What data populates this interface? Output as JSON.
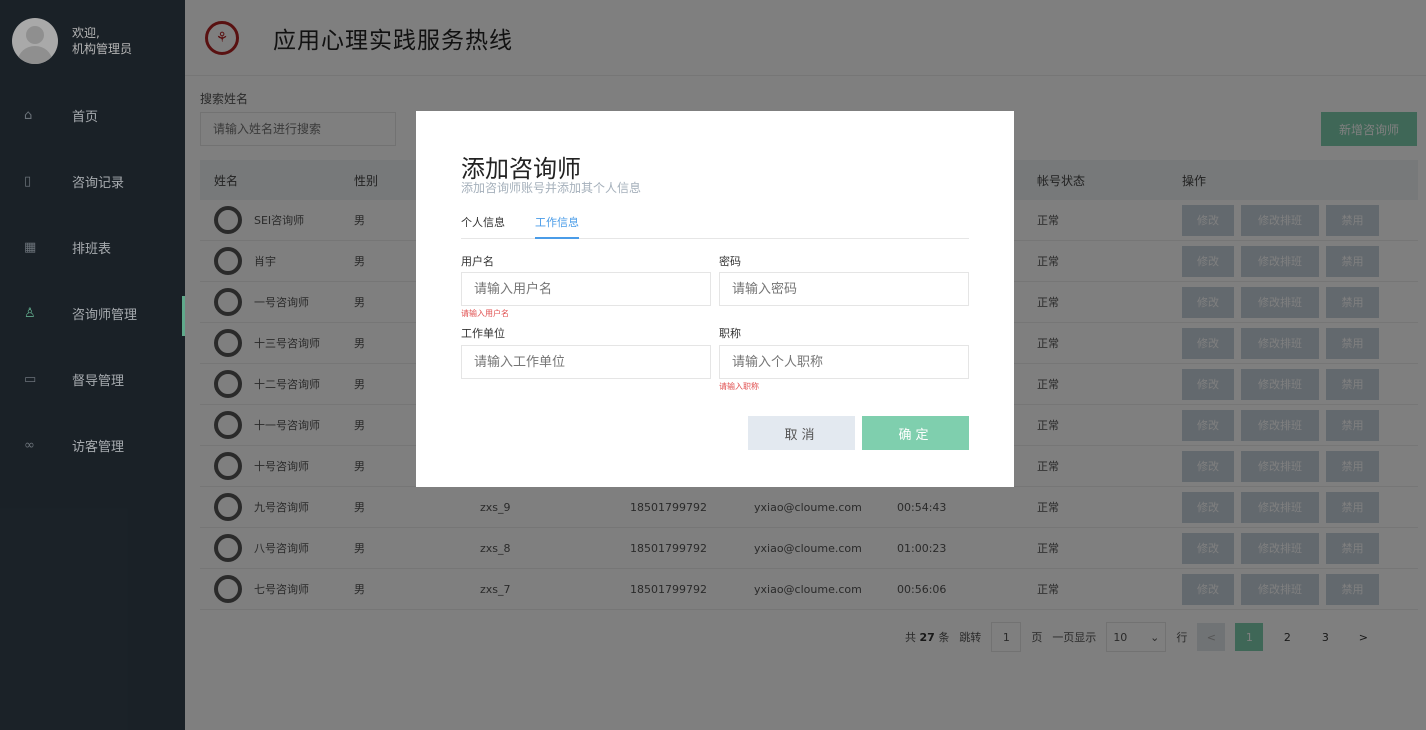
{
  "sidebar": {
    "welcome_line1": "欢迎,",
    "welcome_line2": "机构管理员",
    "items": [
      {
        "label": "首页",
        "icon": "home-icon",
        "glyph": "⌂"
      },
      {
        "label": "咨询记录",
        "icon": "record-icon",
        "glyph": "▯"
      },
      {
        "label": "排班表",
        "icon": "calendar-icon",
        "glyph": "▦"
      },
      {
        "label": "咨询师管理",
        "icon": "user-icon",
        "glyph": "♙"
      },
      {
        "label": "督导管理",
        "icon": "monitor-icon",
        "glyph": "▭"
      },
      {
        "label": "访客管理",
        "icon": "glasses-icon",
        "glyph": "∞"
      }
    ],
    "accent_color": "#7bd9b2"
  },
  "header": {
    "title": "应用心理实践服务热线",
    "logo_glyph": "⚘"
  },
  "search": {
    "label": "搜索姓名",
    "placeholder": "请输入姓名进行搜索"
  },
  "add_button": "新增咨询师",
  "table": {
    "headers": [
      "姓名",
      "性别",
      "",
      "",
      "",
      "",
      "帐号状态",
      "操作"
    ],
    "rows": [
      {
        "name": "SEI咨询师",
        "gender": "男",
        "username": "",
        "phone": "",
        "email": "",
        "time": "",
        "status": "正常"
      },
      {
        "name": "肖宇",
        "gender": "男",
        "username": "",
        "phone": "",
        "email": "",
        "time": "",
        "status": "正常"
      },
      {
        "name": "一号咨询师",
        "gender": "男",
        "username": "",
        "phone": "",
        "email": "",
        "time": "",
        "status": "正常"
      },
      {
        "name": "十三号咨询师",
        "gender": "男",
        "username": "",
        "phone": "",
        "email": "",
        "time": "",
        "status": "正常"
      },
      {
        "name": "十二号咨询师",
        "gender": "男",
        "username": "",
        "phone": "",
        "email": "",
        "time": "",
        "status": "正常"
      },
      {
        "name": "十一号咨询师",
        "gender": "男",
        "username": "",
        "phone": "",
        "email": "",
        "time": "",
        "status": "正常"
      },
      {
        "name": "十号咨询师",
        "gender": "男",
        "username": "",
        "phone": "",
        "email": "",
        "time": "",
        "status": "正常"
      },
      {
        "name": "九号咨询师",
        "gender": "男",
        "username": "zxs_9",
        "phone": "18501799792",
        "email": "yxiao@cloume.com",
        "time": "00:54:43",
        "status": "正常"
      },
      {
        "name": "八号咨询师",
        "gender": "男",
        "username": "zxs_8",
        "phone": "18501799792",
        "email": "yxiao@cloume.com",
        "time": "01:00:23",
        "status": "正常"
      },
      {
        "name": "七号咨询师",
        "gender": "男",
        "username": "zxs_7",
        "phone": "18501799792",
        "email": "yxiao@cloume.com",
        "time": "00:56:06",
        "status": "正常"
      }
    ],
    "ops": {
      "edit": "修改",
      "schedule": "修改排班",
      "ban": "禁用"
    }
  },
  "pager": {
    "total_prefix": "共",
    "total": "27",
    "total_suffix": "条",
    "jump_label": "跳转",
    "jump_value": "1",
    "page_unit": "页",
    "per_page_label": "一页显示",
    "per_page_value": "10",
    "row_unit": "行",
    "prev": "<",
    "pages": [
      "1",
      "2",
      "3"
    ],
    "next": ">",
    "current_page": "1"
  },
  "modal": {
    "title": "添加咨询师",
    "subtitle": "添加咨询师账号并添加其个人信息",
    "tabs": [
      "个人信息",
      "工作信息"
    ],
    "active_tab": "工作信息",
    "fields": {
      "username_label": "用户名",
      "username_placeholder": "请输入用户名",
      "username_error": "请输入用户名",
      "password_label": "密码",
      "password_placeholder": "请输入密码",
      "work_unit_label": "工作单位",
      "work_unit_placeholder": "请输入工作单位",
      "job_title_label": "职称",
      "job_title_placeholder": "请输入个人职称",
      "job_title_error": "请输入职称"
    },
    "cancel": "取消",
    "confirm": "确定"
  }
}
